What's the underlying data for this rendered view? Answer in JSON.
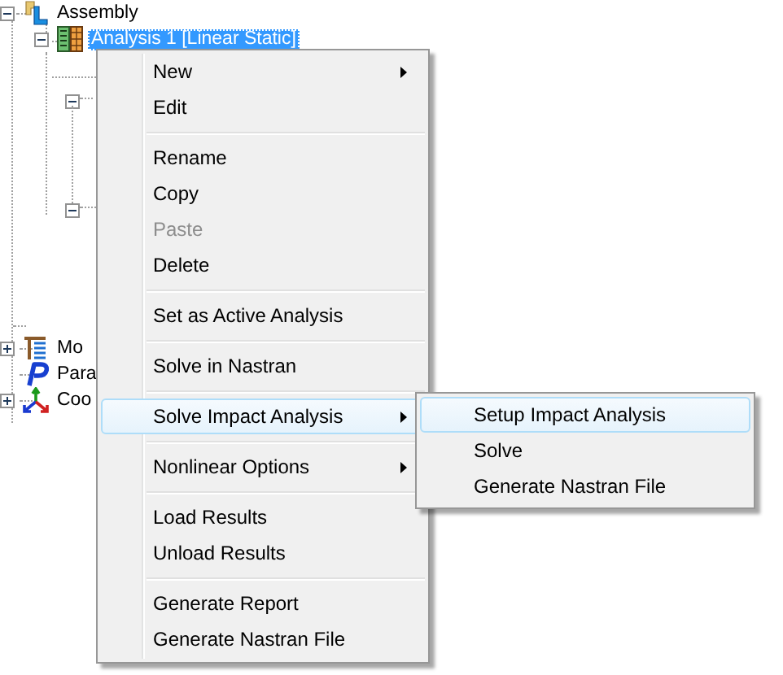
{
  "tree": {
    "items": [
      {
        "label": "Assembly",
        "expandable": true,
        "expanded": true,
        "selected": false,
        "children": [
          {
            "label": "Analysis 1 [Linear Static]",
            "expandable": true,
            "expanded": true,
            "selected": true
          }
        ]
      },
      {
        "label": "Mo",
        "expandable": true,
        "expanded": false,
        "selected": false
      },
      {
        "label": "Para",
        "expandable": false,
        "selected": false
      },
      {
        "label": "Coo",
        "expandable": true,
        "expanded": false,
        "selected": false
      }
    ]
  },
  "context_menu": {
    "items": [
      {
        "kind": "item",
        "label": "New",
        "submenu_arrow": true,
        "disabled": false,
        "selected": false
      },
      {
        "kind": "item",
        "label": "Edit",
        "submenu_arrow": false,
        "disabled": false,
        "selected": false
      },
      {
        "kind": "separator"
      },
      {
        "kind": "item",
        "label": "Rename",
        "submenu_arrow": false,
        "disabled": false,
        "selected": false
      },
      {
        "kind": "item",
        "label": "Copy",
        "submenu_arrow": false,
        "disabled": false,
        "selected": false
      },
      {
        "kind": "item",
        "label": "Paste",
        "submenu_arrow": false,
        "disabled": true,
        "selected": false
      },
      {
        "kind": "item",
        "label": "Delete",
        "submenu_arrow": false,
        "disabled": false,
        "selected": false
      },
      {
        "kind": "separator"
      },
      {
        "kind": "item",
        "label": "Set as Active Analysis",
        "submenu_arrow": false,
        "disabled": false,
        "selected": false
      },
      {
        "kind": "separator"
      },
      {
        "kind": "item",
        "label": "Solve in Nastran",
        "submenu_arrow": false,
        "disabled": false,
        "selected": false
      },
      {
        "kind": "separator"
      },
      {
        "kind": "item",
        "label": "Solve Impact Analysis",
        "submenu_arrow": true,
        "disabled": false,
        "selected": true,
        "submenu": [
          {
            "label": "Setup Impact Analysis",
            "selected": true
          },
          {
            "label": "Solve",
            "selected": false
          },
          {
            "label": "Generate Nastran File",
            "selected": false
          }
        ]
      },
      {
        "kind": "separator"
      },
      {
        "kind": "item",
        "label": "Nonlinear Options",
        "submenu_arrow": true,
        "disabled": false,
        "selected": false
      },
      {
        "kind": "separator"
      },
      {
        "kind": "item",
        "label": "Load Results",
        "submenu_arrow": false,
        "disabled": false,
        "selected": false
      },
      {
        "kind": "item",
        "label": "Unload Results",
        "submenu_arrow": false,
        "disabled": false,
        "selected": false
      },
      {
        "kind": "separator"
      },
      {
        "kind": "item",
        "label": "Generate Report",
        "submenu_arrow": false,
        "disabled": false,
        "selected": false
      },
      {
        "kind": "item",
        "label": "Generate Nastran File",
        "submenu_arrow": false,
        "disabled": false,
        "selected": false
      }
    ]
  }
}
